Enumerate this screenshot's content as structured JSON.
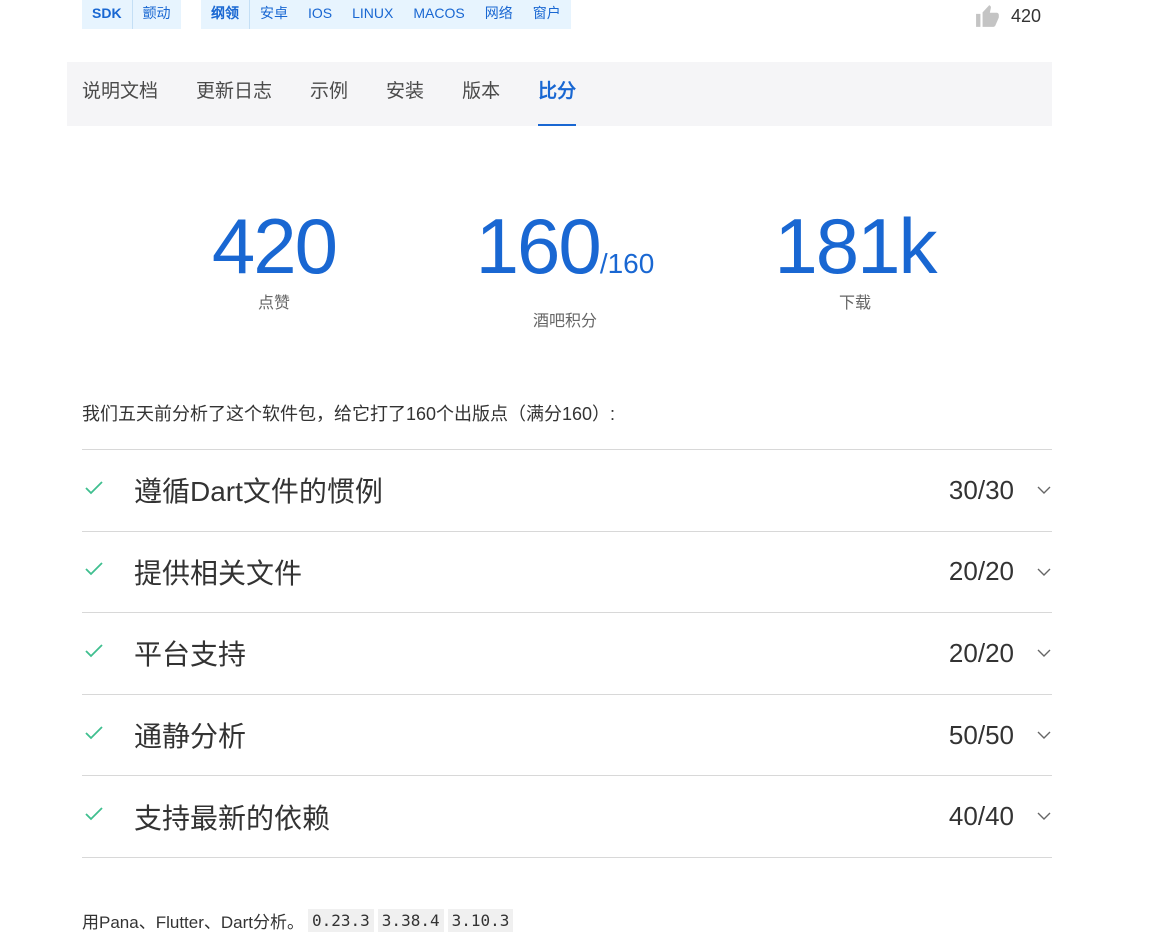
{
  "tags": {
    "group1": [
      "SDK",
      "颤动"
    ],
    "group2": [
      "纲领",
      "安卓",
      "IOS",
      "LINUX",
      "MACOS",
      "网络",
      "窗户"
    ]
  },
  "likes_top": {
    "count": "420",
    "icon": "thumb-up-icon"
  },
  "tabs": [
    {
      "label": "说明文档"
    },
    {
      "label": "更新日志"
    },
    {
      "label": "示例"
    },
    {
      "label": "安装"
    },
    {
      "label": "版本"
    },
    {
      "label": "比分",
      "active": true
    }
  ],
  "stats": {
    "likes": {
      "value": "420",
      "label": "点赞"
    },
    "points": {
      "value": "160",
      "max": "/160",
      "label": "酒吧积分"
    },
    "downloads": {
      "value": "181k",
      "label": "下载"
    }
  },
  "summary": "我们五天前分析了这个软件包，给它打了160个出版点（满分160）:",
  "rows": [
    {
      "title": "遵循Dart文件的惯例",
      "score": "30/30"
    },
    {
      "title": "提供相关文件",
      "score": "20/20"
    },
    {
      "title": "平台支持",
      "score": "20/20"
    },
    {
      "title": "通静分析",
      "score": "50/50"
    },
    {
      "title": "支持最新的依赖",
      "score": "40/40"
    }
  ],
  "footer": {
    "text": "用Pana、Flutter、Dart分析。",
    "versions": [
      "0.23.3",
      "3.38.4",
      "3.10.3"
    ]
  },
  "colors": {
    "accent": "#1967d2",
    "check": "#3fbf8f",
    "tag_bg": "#e7f4fe"
  }
}
